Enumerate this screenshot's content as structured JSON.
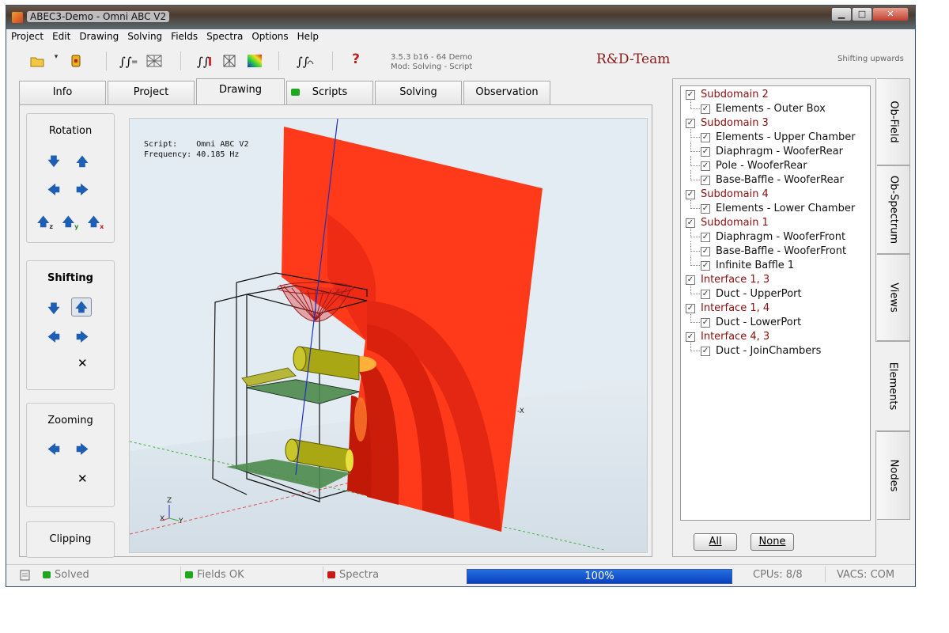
{
  "window": {
    "title": "ABEC3-Demo - Omni ABC V2",
    "minimize": "▁",
    "maximize": "□",
    "close": "✕"
  },
  "menu": [
    "Project",
    "Edit",
    "Drawing",
    "Solving",
    "Fields",
    "Spectra",
    "Options",
    "Help"
  ],
  "toolbar": {
    "icons": [
      "open-folder-icon",
      "dropdown-icon",
      "save-icon",
      "integrate-icon",
      "mesh-icon",
      "field-integrate-icon",
      "wireframe-icon",
      "color-map-icon",
      "spectrum-icon",
      "help-icon"
    ],
    "help_glyph": "?",
    "version_line1": "3.5.3 b16 - 64 Demo",
    "version_line2": "Mod: Solving - Script",
    "team": "R&D-Team",
    "status_message": "Shifting upwards"
  },
  "tabs": [
    {
      "label": "Info",
      "active": false
    },
    {
      "label": "Project",
      "active": false
    },
    {
      "label": "Drawing",
      "active": true
    },
    {
      "label": "Scripts",
      "active": false,
      "indicator": "#1fa81f"
    },
    {
      "label": "Solving",
      "active": false
    },
    {
      "label": "Observation",
      "active": false
    }
  ],
  "controls": {
    "rotation": "Rotation",
    "shifting": "Shifting",
    "zooming": "Zooming",
    "clipping": "Clipping",
    "axis_z": "z",
    "axis_y": "y",
    "axis_x": "x",
    "reset": "✕"
  },
  "viewport": {
    "script_label": "Script:",
    "script_value": "Omni ABC V2",
    "frequency_label": "Frequency:",
    "frequency_value": "40.185 Hz",
    "axis_label": "-X",
    "triad_z": "Z",
    "triad_y": "Y",
    "triad_x": "X"
  },
  "tree": [
    {
      "label": "Subdomain 2",
      "level": 0,
      "checked": true
    },
    {
      "label": "Elements - Outer Box",
      "level": 1,
      "checked": true
    },
    {
      "label": "Subdomain 3",
      "level": 0,
      "checked": true
    },
    {
      "label": "Elements - Upper Chamber",
      "level": 1,
      "checked": true
    },
    {
      "label": "Diaphragm - WooferRear",
      "level": 1,
      "checked": true
    },
    {
      "label": "Pole - WooferRear",
      "level": 1,
      "checked": true
    },
    {
      "label": "Base-Baffle - WooferRear",
      "level": 1,
      "checked": true
    },
    {
      "label": "Subdomain 4",
      "level": 0,
      "checked": true
    },
    {
      "label": "Elements - Lower Chamber",
      "level": 1,
      "checked": true
    },
    {
      "label": "Subdomain 1",
      "level": 0,
      "checked": true
    },
    {
      "label": "Diaphragm - WooferFront",
      "level": 1,
      "checked": true
    },
    {
      "label": "Base-Baffle - WooferFront",
      "level": 1,
      "checked": true
    },
    {
      "label": "Infinite Baffle 1",
      "level": 1,
      "checked": true
    },
    {
      "label": "Interface 1, 3",
      "level": 0,
      "checked": true
    },
    {
      "label": "Duct - UpperPort",
      "level": 1,
      "checked": true
    },
    {
      "label": "Interface 1, 4",
      "level": 0,
      "checked": true
    },
    {
      "label": "Duct - LowerPort",
      "level": 1,
      "checked": true
    },
    {
      "label": "Interface 4, 3",
      "level": 0,
      "checked": true
    },
    {
      "label": "Duct - JoinChambers",
      "level": 1,
      "checked": true
    }
  ],
  "tree_buttons": {
    "all": "All",
    "none": "None"
  },
  "side_tabs": [
    {
      "label": "Ob-Field",
      "active": false
    },
    {
      "label": "Ob-Spectrum",
      "active": false
    },
    {
      "label": "Views",
      "active": false
    },
    {
      "label": "Elements",
      "active": true
    },
    {
      "label": "Nodes",
      "active": false
    }
  ],
  "statusbar": {
    "solved": "Solved",
    "fields": "Fields OK",
    "spectra": "Spectra",
    "progress": "100%",
    "progress_value": 1.0,
    "cpus": "CPUs: 8/8",
    "vacs": "VACS: COM"
  },
  "colors": {
    "led_green": "#1fa81f",
    "led_red": "#c81818",
    "tree_parent": "#8b0e0e",
    "progress": "#1447d0",
    "field_hot": "#ff3a1a"
  }
}
